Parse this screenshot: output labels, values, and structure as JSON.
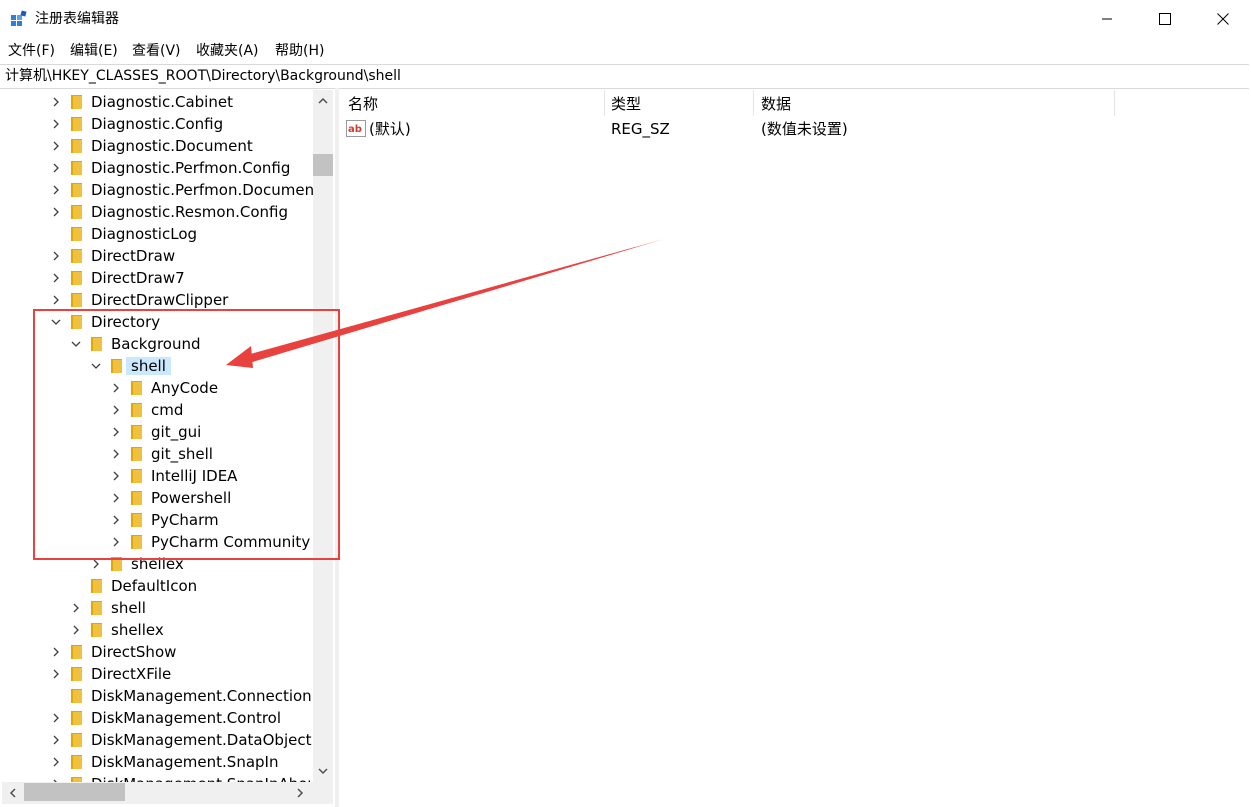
{
  "window": {
    "title": "注册表编辑器",
    "controls": {
      "minimize": "minimize",
      "maximize": "maximize",
      "close": "close"
    }
  },
  "menu": {
    "file": "文件(F)",
    "edit": "编辑(E)",
    "view": "查看(V)",
    "favorites": "收藏夹(A)",
    "help": "帮助(H)"
  },
  "address": {
    "path": "计算机\\HKEY_CLASSES_ROOT\\Directory\\Background\\shell"
  },
  "tree": {
    "items": [
      {
        "label": "Diagnostic.Cabinet",
        "depth": 0,
        "expander": "collapsed"
      },
      {
        "label": "Diagnostic.Config",
        "depth": 0,
        "expander": "collapsed"
      },
      {
        "label": "Diagnostic.Document",
        "depth": 0,
        "expander": "collapsed"
      },
      {
        "label": "Diagnostic.Perfmon.Config",
        "depth": 0,
        "expander": "collapsed"
      },
      {
        "label": "Diagnostic.Perfmon.Document",
        "depth": 0,
        "expander": "collapsed"
      },
      {
        "label": "Diagnostic.Resmon.Config",
        "depth": 0,
        "expander": "collapsed"
      },
      {
        "label": "DiagnosticLog",
        "depth": 0,
        "expander": "none"
      },
      {
        "label": "DirectDraw",
        "depth": 0,
        "expander": "collapsed"
      },
      {
        "label": "DirectDraw7",
        "depth": 0,
        "expander": "collapsed"
      },
      {
        "label": "DirectDrawClipper",
        "depth": 0,
        "expander": "collapsed"
      },
      {
        "label": "Directory",
        "depth": 0,
        "expander": "expanded"
      },
      {
        "label": "Background",
        "depth": 1,
        "expander": "expanded"
      },
      {
        "label": "shell",
        "depth": 2,
        "expander": "expanded",
        "selected": true
      },
      {
        "label": "AnyCode",
        "depth": 3,
        "expander": "collapsed"
      },
      {
        "label": "cmd",
        "depth": 3,
        "expander": "collapsed"
      },
      {
        "label": "git_gui",
        "depth": 3,
        "expander": "collapsed"
      },
      {
        "label": "git_shell",
        "depth": 3,
        "expander": "collapsed"
      },
      {
        "label": "IntelliJ IDEA",
        "depth": 3,
        "expander": "collapsed"
      },
      {
        "label": "Powershell",
        "depth": 3,
        "expander": "collapsed"
      },
      {
        "label": "PyCharm",
        "depth": 3,
        "expander": "collapsed"
      },
      {
        "label": "PyCharm Community E",
        "depth": 3,
        "expander": "collapsed"
      },
      {
        "label": "shellex",
        "depth": 2,
        "expander": "collapsed"
      },
      {
        "label": "DefaultIcon",
        "depth": 1,
        "expander": "none"
      },
      {
        "label": "shell",
        "depth": 1,
        "expander": "collapsed"
      },
      {
        "label": "shellex",
        "depth": 1,
        "expander": "collapsed"
      },
      {
        "label": "DirectShow",
        "depth": 0,
        "expander": "collapsed"
      },
      {
        "label": "DirectXFile",
        "depth": 0,
        "expander": "collapsed"
      },
      {
        "label": "DiskManagement.Connection",
        "depth": 0,
        "expander": "none"
      },
      {
        "label": "DiskManagement.Control",
        "depth": 0,
        "expander": "collapsed"
      },
      {
        "label": "DiskManagement.DataObject",
        "depth": 0,
        "expander": "collapsed"
      },
      {
        "label": "DiskManagement.SnapIn",
        "depth": 0,
        "expander": "collapsed"
      },
      {
        "label": "DiskManagement.SnapInAbou",
        "depth": 0,
        "expander": "collapsed"
      }
    ]
  },
  "values": {
    "headers": {
      "name": "名称",
      "type": "类型",
      "data": "数据"
    },
    "rows": [
      {
        "icon": "string-value-icon",
        "name": "(默认)",
        "type": "REG_SZ",
        "data": "(数值未设置)"
      }
    ]
  },
  "colors": {
    "annotation": "#e8413e",
    "selection": "#cce8ff",
    "folder": "#f0c040"
  },
  "icons": {
    "app": "registry-editor-icon",
    "folder": "folder-icon",
    "expand": "chevron-right-icon",
    "collapse": "chevron-down-icon"
  }
}
